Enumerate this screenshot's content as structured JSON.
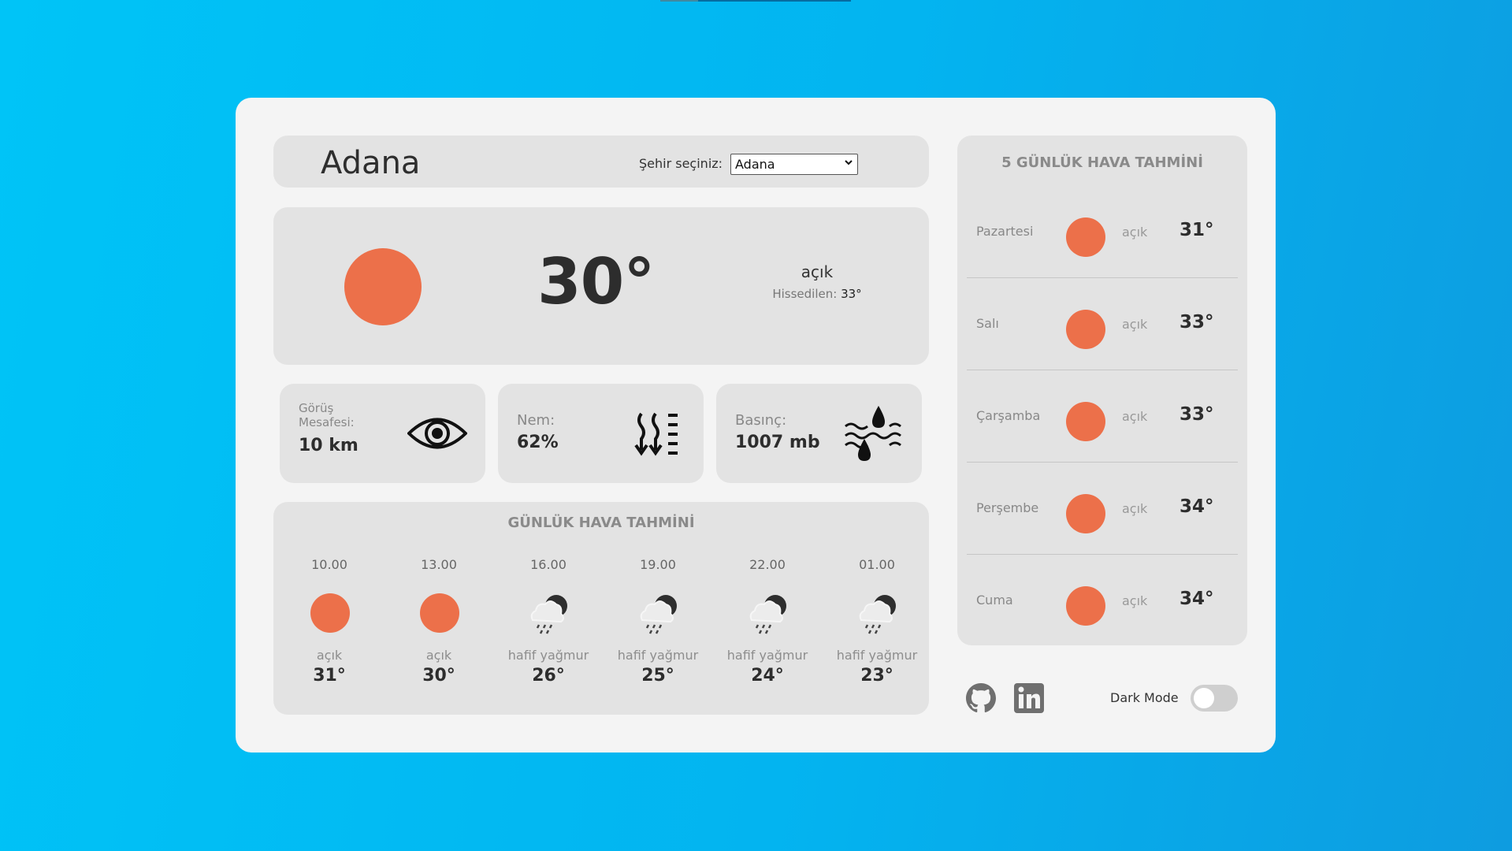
{
  "header": {
    "city": "Adana",
    "select_label": "Şehir seçiniz:",
    "selected_city": "Adana"
  },
  "current": {
    "temp": "30°",
    "description": "açık",
    "feels_label": "Hissedilen:",
    "feels_value": "33°",
    "icon": "sun-icon"
  },
  "stats": {
    "visibility": {
      "label": "Görüş Mesafesi:",
      "value": "10 km",
      "icon": "eye-icon"
    },
    "humidity": {
      "label": "Nem:",
      "value": "62%",
      "icon": "humidity-icon"
    },
    "pressure": {
      "label": "Basınç:",
      "value": "1007 mb",
      "icon": "pressure-icon"
    }
  },
  "daily": {
    "title": "GÜNLÜK HAVA TAHMİNİ",
    "hours": [
      {
        "time": "10.00",
        "desc": "açık",
        "temp": "31°",
        "icon": "sun-icon"
      },
      {
        "time": "13.00",
        "desc": "açık",
        "temp": "30°",
        "icon": "sun-icon"
      },
      {
        "time": "16.00",
        "desc": "hafif yağmur",
        "temp": "26°",
        "icon": "rain-cloud-icon"
      },
      {
        "time": "19.00",
        "desc": "hafif yağmur",
        "temp": "25°",
        "icon": "rain-cloud-icon"
      },
      {
        "time": "22.00",
        "desc": "hafif yağmur",
        "temp": "24°",
        "icon": "rain-cloud-icon"
      },
      {
        "time": "01.00",
        "desc": "hafif yağmur",
        "temp": "23°",
        "icon": "rain-cloud-icon"
      }
    ]
  },
  "forecast": {
    "title": "5 GÜNLÜK HAVA TAHMİNİ",
    "days": [
      {
        "day": "Pazartesi",
        "desc": "açık",
        "temp": "31°"
      },
      {
        "day": "Salı",
        "desc": "açık",
        "temp": "33°"
      },
      {
        "day": "Çarşamba",
        "desc": "açık",
        "temp": "33°"
      },
      {
        "day": "Perşembe",
        "desc": "açık",
        "temp": "34°"
      },
      {
        "day": "Cuma",
        "desc": "açık",
        "temp": "34°"
      }
    ]
  },
  "footer": {
    "dark_mode_label": "Dark Mode",
    "dark_mode_on": false
  },
  "colors": {
    "sun": "#ec704a",
    "panel": "#e3e3e3",
    "card": "#f4f4f4",
    "background_from": "#00c4f7",
    "background_to": "#0e9ce0"
  }
}
